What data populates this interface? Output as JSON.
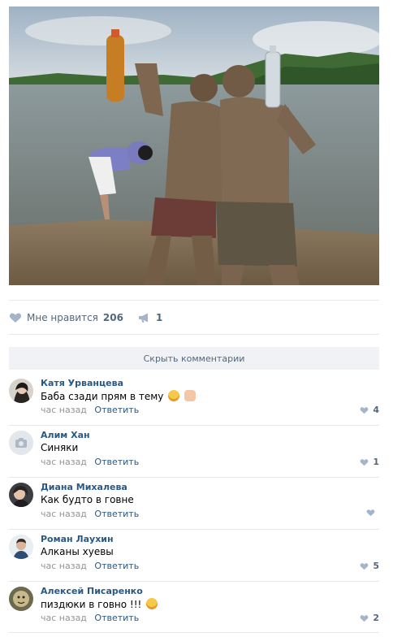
{
  "post": {
    "likes_label": "Мне нравится",
    "likes_count": "206",
    "shares_count": "1"
  },
  "comments_toggle": "Скрыть комментарии",
  "comments": [
    {
      "author": "Катя Урванцева",
      "text": "Баба сзади прям в тему",
      "emoji": [
        "laughing-tears-emoji",
        "ok-hand-emoji"
      ],
      "time": "час назад",
      "reply": "Ответить",
      "likes": "4"
    },
    {
      "author": "Алим Хан",
      "text": "Синяки",
      "emoji": [],
      "time": "час назад",
      "reply": "Ответить",
      "likes": "1"
    },
    {
      "author": "Диана Михалева",
      "text": "Как будто в говне",
      "emoji": [],
      "time": "час назад",
      "reply": "Ответить",
      "likes": ""
    },
    {
      "author": "Роман Лаухин",
      "text": "Алканы хуевы",
      "emoji": [],
      "time": "час назад",
      "reply": "Ответить",
      "likes": "5"
    },
    {
      "author": "Алексей Писаренко",
      "text": "пиздюки в говно !!!",
      "emoji": [
        "grinning-squint-emoji"
      ],
      "time": "час назад",
      "reply": "Ответить",
      "likes": "2"
    }
  ],
  "colors": {
    "link": "#2a5885",
    "muted": "#939393",
    "action": "#55677d",
    "toggle_bg": "#f0f2f5"
  }
}
